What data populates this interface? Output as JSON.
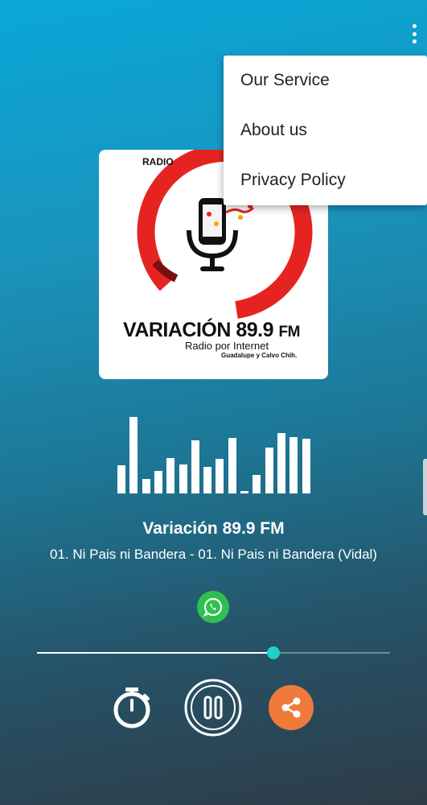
{
  "menu": {
    "items": [
      {
        "label": "Our Service"
      },
      {
        "label": "About us"
      },
      {
        "label": "Privacy Policy"
      }
    ]
  },
  "logo": {
    "radio": "RADIO",
    "name_main": "VARIACIÓN 89.9",
    "name_fm": "FM",
    "subtitle": "Radio por Internet",
    "location": "Guadalupe y Calvo Chih."
  },
  "player": {
    "station": "Variación 89.9 FM",
    "track": "01. Ni Pais ni Bandera - 01. Ni Pais ni Bandera (Vidal)",
    "progress": 0.67,
    "visualizer_levels": [
      0.32,
      0.88,
      0.17,
      0.26,
      0.41,
      0.33,
      0.61,
      0.31,
      0.4,
      0.64,
      0.03,
      0.21,
      0.53,
      0.69,
      0.65,
      0.63
    ]
  },
  "icons": {
    "overflow": "more-vert-icon",
    "whatsapp": "whatsapp-icon",
    "timer": "timer-icon",
    "pause": "pause-icon",
    "share": "share-icon"
  },
  "colors": {
    "accent": "#1fd1c8",
    "share": "#f07a3a",
    "whatsapp": "#2ec04f",
    "logo_red": "#e52421"
  }
}
